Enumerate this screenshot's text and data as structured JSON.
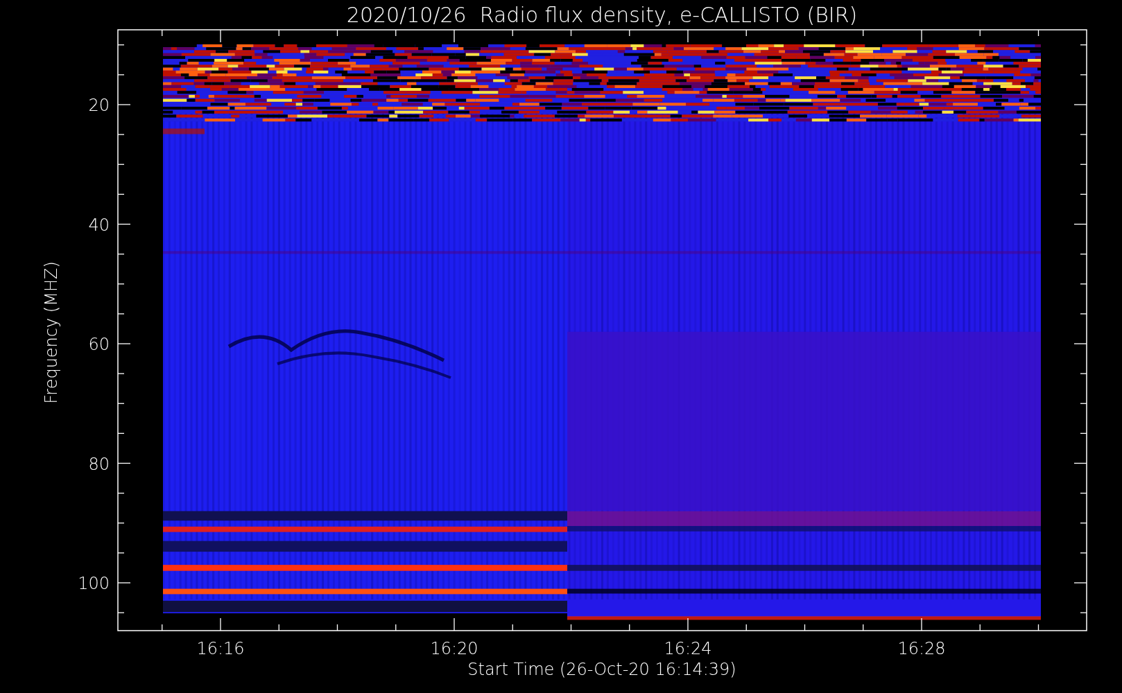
{
  "title": "2020/10/26  Radio flux density, e-CALLISTO (BIR)",
  "plot": {
    "ylabel": "Frequency (MHZ)",
    "xlabel": "Start Time (26-Oct-20 16:14:39)",
    "yticks": [
      "20",
      "40",
      "60",
      "80",
      "100"
    ],
    "xticks": [
      "16:16",
      "16:20",
      "16:24",
      "16:28"
    ]
  }
}
